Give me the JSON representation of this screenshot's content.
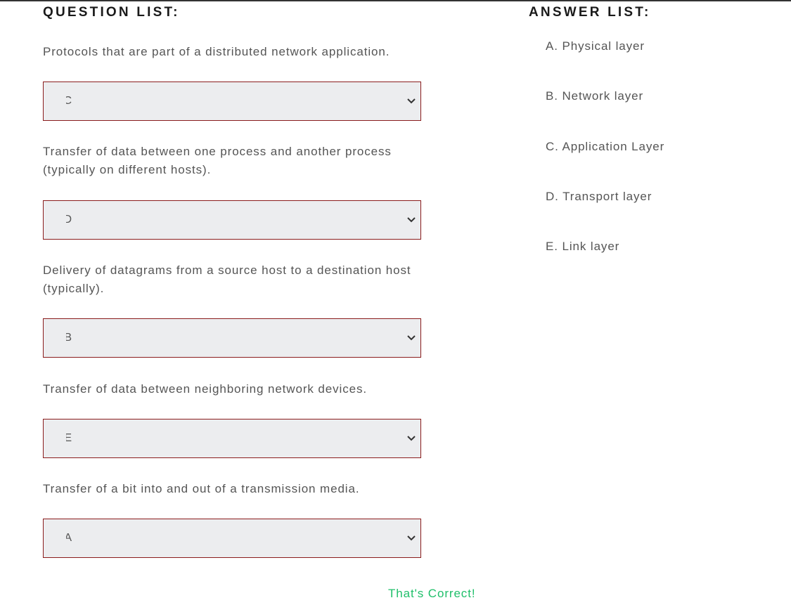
{
  "headings": {
    "questions": "QUESTION LIST:",
    "answers": "ANSWER LIST:"
  },
  "questions": [
    {
      "text": "Protocols that are part of a distributed network application.",
      "selected": "C"
    },
    {
      "text": "Transfer of data between one process and another process (typically on different hosts).",
      "selected": "D"
    },
    {
      "text": "Delivery of datagrams from a source host to a destination host (typically).",
      "selected": "B"
    },
    {
      "text": "Transfer of data between neighboring network devices.",
      "selected": "E"
    },
    {
      "text": "Transfer of a bit into and out of a transmission media.",
      "selected": "A"
    }
  ],
  "answers": [
    "A. Physical layer",
    "B. Network layer",
    "C. Application Layer",
    "D. Transport layer",
    "E. Link layer"
  ],
  "feedback": "That's Correct!",
  "icons": {
    "select_arrow": "chevron-down-icon"
  },
  "colors": {
    "select_border": "#8a1c1c",
    "select_background": "#ecedef",
    "feedback": "#1fbf6a"
  }
}
